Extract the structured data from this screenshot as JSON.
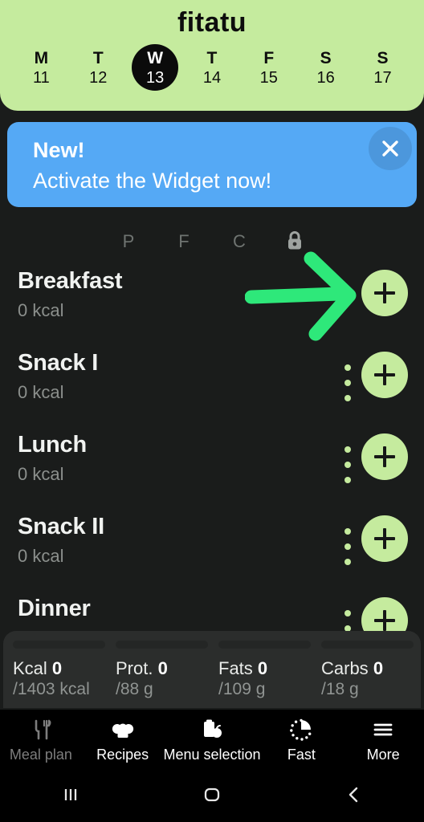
{
  "app": {
    "brand": "fitatu",
    "accent_green": "#c5eb9e",
    "annotation_green": "#2ee87a",
    "banner_blue": "#55a9f5",
    "background": "#1a1c1b"
  },
  "header": {
    "days": [
      {
        "dow": "M",
        "num": "11",
        "selected": false
      },
      {
        "dow": "T",
        "num": "12",
        "selected": false
      },
      {
        "dow": "W",
        "num": "13",
        "selected": true
      },
      {
        "dow": "T",
        "num": "14",
        "selected": false
      },
      {
        "dow": "F",
        "num": "15",
        "selected": false
      },
      {
        "dow": "S",
        "num": "16",
        "selected": false
      },
      {
        "dow": "S",
        "num": "17",
        "selected": false
      }
    ]
  },
  "banner": {
    "title": "New!",
    "subtitle": "Activate the Widget now!",
    "close_icon": "close-icon"
  },
  "macro_header": {
    "p": "P",
    "f": "F",
    "c": "C",
    "lock_icon": "lock-icon"
  },
  "meals": [
    {
      "name": "Breakfast",
      "kcal": "0 kcal",
      "has_menu": false
    },
    {
      "name": "Snack I",
      "kcal": "0 kcal",
      "has_menu": true
    },
    {
      "name": "Lunch",
      "kcal": "0 kcal",
      "has_menu": true
    },
    {
      "name": "Snack II",
      "kcal": "0 kcal",
      "has_menu": true
    },
    {
      "name": "Dinner",
      "kcal": "",
      "has_menu": true
    }
  ],
  "summary": [
    {
      "label": "Kcal",
      "value": "0",
      "goal": "/1403 kcal",
      "progress": 0
    },
    {
      "label": "Prot.",
      "value": "0",
      "goal": "/88 g",
      "progress": 0
    },
    {
      "label": "Fats",
      "value": "0",
      "goal": "/109 g",
      "progress": 0
    },
    {
      "label": "Carbs",
      "value": "0",
      "goal": "/18 g",
      "progress": 0
    }
  ],
  "tabs": [
    {
      "label": "Meal plan",
      "icon": "fork-knife-icon",
      "active": false
    },
    {
      "label": "Recipes",
      "icon": "chef-hat-icon",
      "active": true
    },
    {
      "label": "Menu selection",
      "icon": "clipboard-apple-icon",
      "active": true
    },
    {
      "label": "Fast",
      "icon": "timer-icon",
      "active": true
    },
    {
      "label": "More",
      "icon": "hamburger-icon",
      "active": true
    }
  ],
  "system_nav": {
    "recents": "recents-icon",
    "home": "home-icon",
    "back": "back-icon"
  },
  "annotation": {
    "arrow": "green-arrow-pointing-to-breakfast-add-button"
  }
}
